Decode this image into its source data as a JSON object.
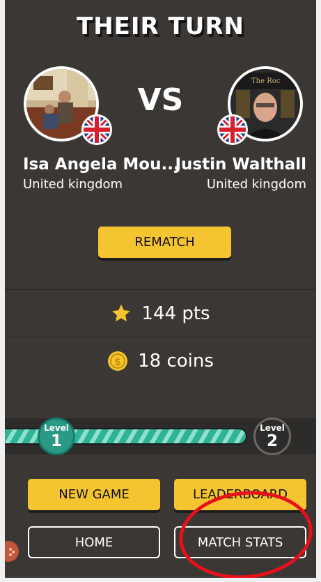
{
  "header": {
    "title": "THEIR TURN",
    "vs": "VS"
  },
  "player1": {
    "name": "Isa Angela Mou...",
    "country": "United kingdom"
  },
  "player2": {
    "name": "Justin Walthall",
    "country": "United kingdom"
  },
  "rematch_label": "REMATCH",
  "stats": {
    "points": "144 pts",
    "coins": "18 coins"
  },
  "progress": {
    "level_word": "Level",
    "current_level": "1",
    "next_level": "2",
    "fraction": 0.95
  },
  "buttons": {
    "new_game": "NEW GAME",
    "leaderboard": "LEADERBOARD",
    "home": "HOME",
    "match_stats": "MATCH STATS"
  },
  "colors": {
    "accent_yellow": "#f5c431",
    "background": "#3a3734",
    "level_teal": "#2fb397",
    "annotation_red": "#e8101a"
  }
}
